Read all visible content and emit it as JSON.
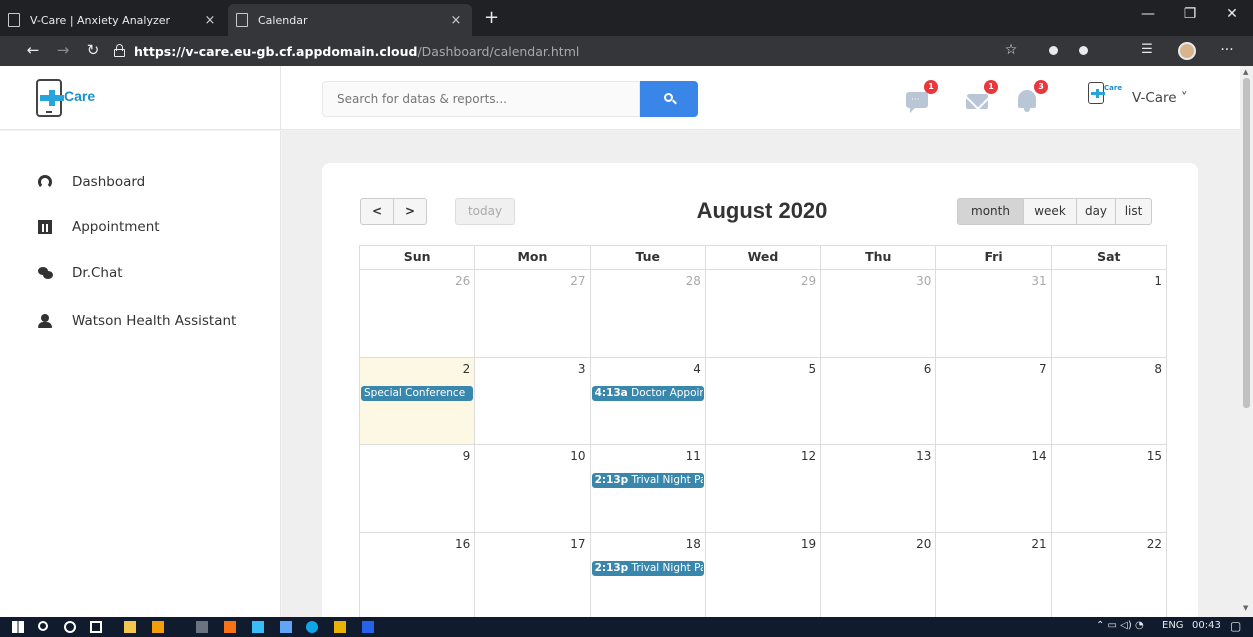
{
  "browser": {
    "tabs": [
      {
        "title": "V-Care | Anxiety Analyzer",
        "active": false
      },
      {
        "title": "Calendar",
        "active": true
      }
    ],
    "new_tab": "+",
    "url_host": "https://v-care.eu-gb.cf.appdomain.cloud",
    "url_path": "/Dashboard/calendar.html"
  },
  "header": {
    "logo_text": "Care",
    "logo_mini_text": "Care",
    "search_placeholder": "Search for datas & reports...",
    "badges": {
      "messages": "1",
      "mail": "1",
      "notifications": "3"
    },
    "profile_name": "V-Care ˅"
  },
  "sidebar": {
    "items": [
      {
        "label": "Dashboard",
        "icon": "dashboard-icon"
      },
      {
        "label": "Appointment",
        "icon": "calendar-icon"
      },
      {
        "label": "Dr.Chat",
        "icon": "chat-icon"
      },
      {
        "label": "Watson Health Assistant",
        "icon": "user-icon"
      }
    ]
  },
  "calendar": {
    "prev": "<",
    "next": ">",
    "today": "today",
    "title": "August 2020",
    "views": [
      "month",
      "week",
      "day",
      "list"
    ],
    "active_view": "month",
    "weekdays": [
      "Sun",
      "Mon",
      "Tue",
      "Wed",
      "Thu",
      "Fri",
      "Sat"
    ],
    "weeks": [
      [
        {
          "d": "26",
          "other": true
        },
        {
          "d": "27",
          "other": true
        },
        {
          "d": "28",
          "other": true
        },
        {
          "d": "29",
          "other": true
        },
        {
          "d": "30",
          "other": true
        },
        {
          "d": "31",
          "other": true
        },
        {
          "d": "1"
        }
      ],
      [
        {
          "d": "2",
          "today": true,
          "event": {
            "time": "",
            "title": "Special Conference"
          }
        },
        {
          "d": "3"
        },
        {
          "d": "4",
          "event": {
            "time": "4:13a",
            "title": " Doctor Appointment"
          }
        },
        {
          "d": "5"
        },
        {
          "d": "6"
        },
        {
          "d": "7"
        },
        {
          "d": "8"
        }
      ],
      [
        {
          "d": "9"
        },
        {
          "d": "10"
        },
        {
          "d": "11",
          "event": {
            "time": "2:13p",
            "title": " Trival Night Party"
          }
        },
        {
          "d": "12"
        },
        {
          "d": "13"
        },
        {
          "d": "14"
        },
        {
          "d": "15"
        }
      ],
      [
        {
          "d": "16"
        },
        {
          "d": "17"
        },
        {
          "d": "18",
          "event": {
            "time": "2:13p",
            "title": " Trival Night Party"
          }
        },
        {
          "d": "19"
        },
        {
          "d": "20"
        },
        {
          "d": "21"
        },
        {
          "d": "22"
        }
      ]
    ]
  },
  "taskbar": {
    "tray_text": "ENG",
    "clock": "00:43"
  },
  "colors": {
    "accent": "#3a86e8",
    "event": "#3a87ad",
    "today_bg": "#fcf8e3",
    "badge": "#e8383d"
  }
}
